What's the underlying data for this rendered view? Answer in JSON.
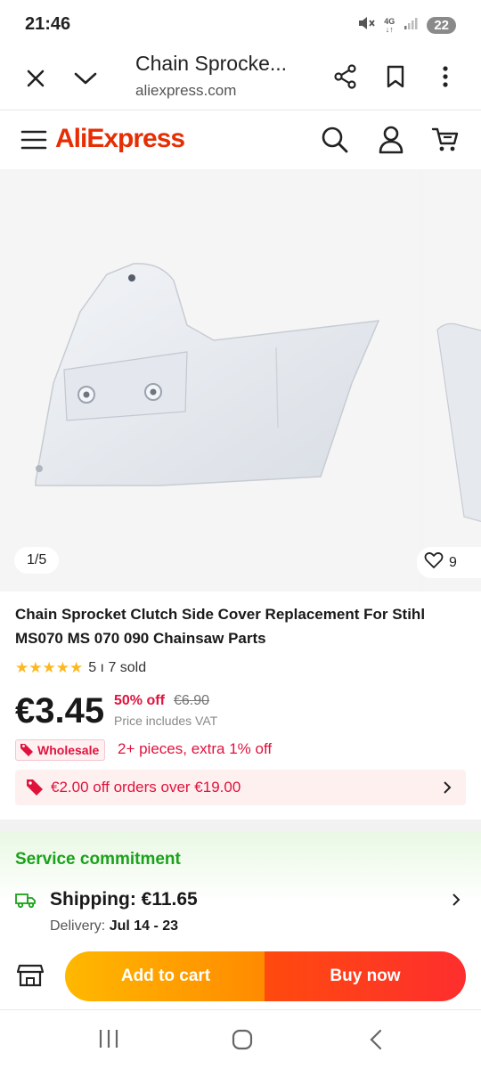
{
  "status_bar": {
    "time": "21:46",
    "network": "4G",
    "battery": "22"
  },
  "browser": {
    "page_title": "Chain Sprocke...",
    "domain": "aliexpress.com"
  },
  "site": {
    "logo_prefix": "Ali",
    "logo_suffix": "Express"
  },
  "gallery": {
    "counter": "1/5",
    "wishlist_count": "9"
  },
  "product": {
    "title": "Chain Sprocket Clutch Side Cover Replacement For Stihl MS070 MS 070 090 Chainsaw Parts",
    "rating_stars": 5,
    "sold": "5 ı 7 sold",
    "price": "€3.45",
    "discount": "50% off",
    "original_price": "€6.90",
    "vat_note": "Price includes VAT",
    "wholesale_label": "Wholesale",
    "wholesale_text": "2+ pieces, extra 1% off",
    "coupon_text": "€2.00 off orders over €19.00"
  },
  "service": {
    "title": "Service commitment",
    "shipping": "Shipping: €11.65",
    "delivery_label": "Delivery: ",
    "delivery_dates": "Jul 14 - 23"
  },
  "actions": {
    "add_to_cart": "Add to cart",
    "buy_now": "Buy now"
  },
  "colors": {
    "brand_red": "#e62e04",
    "price_red": "#e0133d",
    "service_green": "#1aa21a",
    "cart_orange": "#ff9f00",
    "buy_red": "#fe3a1a"
  }
}
